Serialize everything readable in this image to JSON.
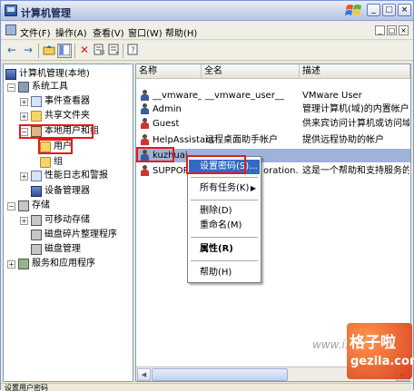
{
  "window": {
    "title": "计算机管理"
  },
  "menubar": {
    "items": [
      "文件(F)",
      "操作(A)",
      "查看(V)",
      "窗口(W)",
      "帮助(H)"
    ],
    "mdi_buttons": [
      "_",
      "□",
      "×"
    ]
  },
  "titlebar": {
    "buttons": [
      "_",
      "□",
      "×"
    ]
  },
  "toolbar": {
    "icons": [
      "back-arrow-icon",
      "forward-arrow-icon",
      "up-folder-icon",
      "show-tree-icon",
      "delete-icon",
      "properties-icon",
      "export-icon",
      "help-icon"
    ]
  },
  "tree": {
    "root": "计算机管理(本地)",
    "items": [
      {
        "label": "系统工具",
        "expander": "−"
      },
      {
        "label": "事件查看器",
        "expander": "+"
      },
      {
        "label": "共享文件夹",
        "expander": "+"
      },
      {
        "label": "本地用户和组",
        "expander": "−"
      },
      {
        "label": "用户",
        "expander": ""
      },
      {
        "label": "组",
        "expander": ""
      },
      {
        "label": "性能日志和警报",
        "expander": "+"
      },
      {
        "label": "设备管理器",
        "expander": ""
      },
      {
        "label": "存储",
        "expander": "−"
      },
      {
        "label": "可移动存储",
        "expander": "+"
      },
      {
        "label": "磁盘碎片整理程序",
        "expander": ""
      },
      {
        "label": "磁盘管理",
        "expander": ""
      },
      {
        "label": "服务和应用程序",
        "expander": "+"
      }
    ]
  },
  "list": {
    "columns": [
      "名称",
      "全名",
      "描述"
    ],
    "rows": [
      {
        "name": "__vmware_u...",
        "fullname": "__vmware_user__",
        "desc": "VMware User"
      },
      {
        "name": "Admin",
        "fullname": "",
        "desc": "管理计算机(域)的内置帐户"
      },
      {
        "name": "Guest",
        "fullname": "",
        "desc": "供来宾访问计算机或访问域的内"
      },
      {
        "name": "HelpAssistant",
        "fullname": "远程桌面助手帐户",
        "desc": "提供远程协助的帐户"
      },
      {
        "name": "kuzhuai",
        "fullname": "",
        "desc": ""
      },
      {
        "name": "SUPPORT_3",
        "fullname": "oration...",
        "desc": "这是一个帮助和支持服务的帐户"
      }
    ]
  },
  "context_menu": {
    "items": [
      "设置密码(S)...",
      "所有任务(K)",
      "删除(D)",
      "重命名(M)",
      "属性(R)",
      "帮助(H)"
    ]
  },
  "statusbar": {
    "text": "设置用户密码"
  },
  "watermark": {
    "url": "www.i...",
    "cn": "格子啦",
    "en": "gezila.com"
  }
}
